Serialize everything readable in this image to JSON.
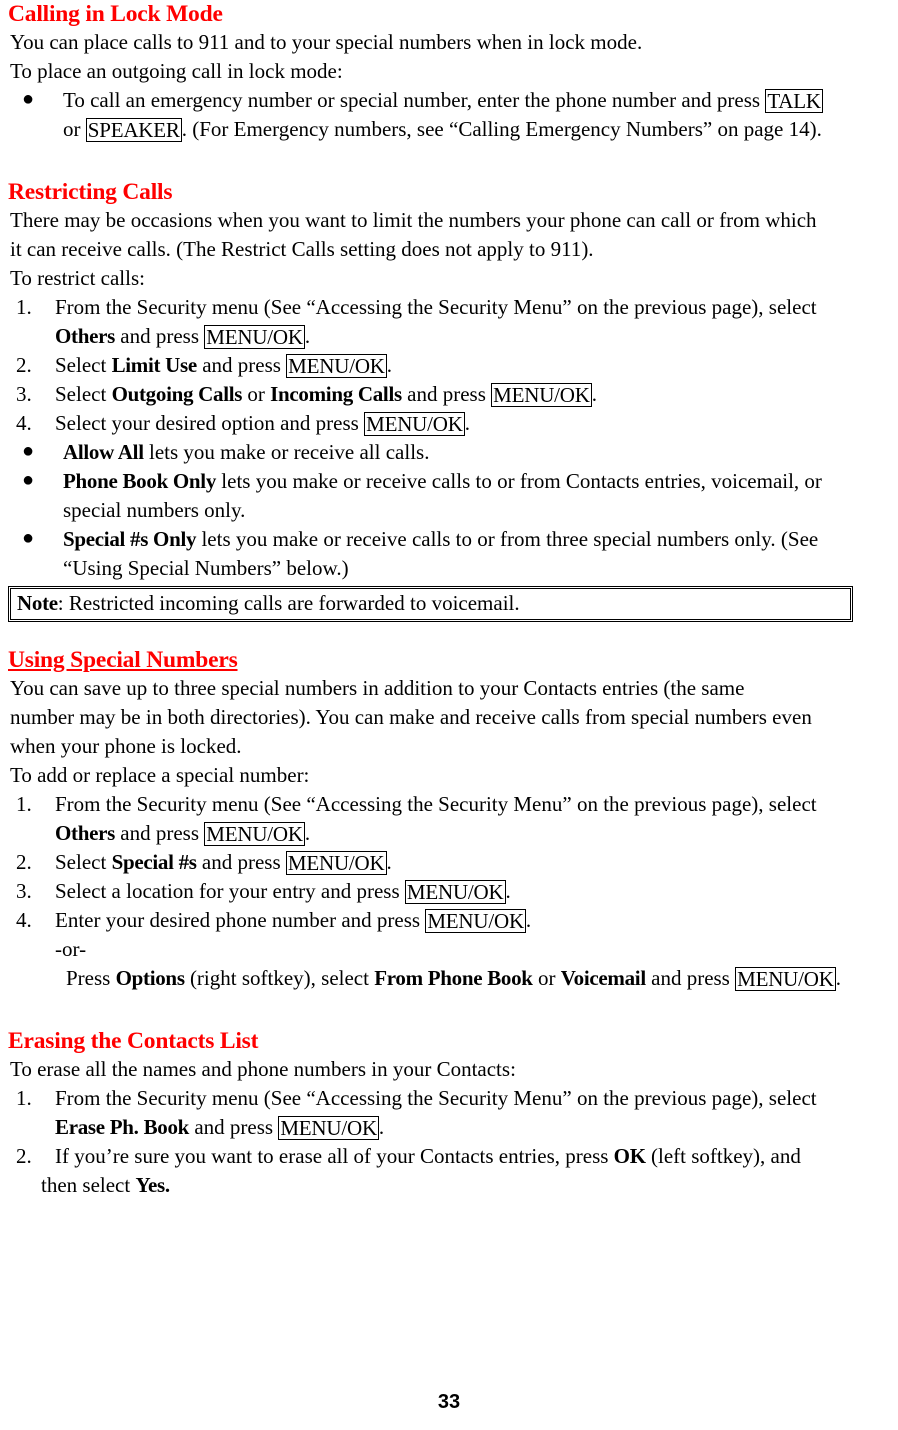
{
  "document": {
    "page_number": "33",
    "heading_color": "#ff0000",
    "text_color": "#000000",
    "background": "#ffffff"
  },
  "sections": [
    {
      "id": "calling-in-lock-mode",
      "heading": "Calling in Lock Mode",
      "heading_style": "red-bold",
      "paragraphs": [
        "You can place calls to 911 and to your special numbers when in lock mode.",
        "To place an outgoing call in lock mode:"
      ],
      "bullets": [
        {
          "lead_bold": "",
          "line1_pre": "To call an emergency number or special number, enter the phone number and press ",
          "key1": "TALK",
          "line2_pre": "or ",
          "key2": "SPEAKER",
          "line2_post": ". (For Emergency numbers, see “Calling Emergency Numbers” on page 14)."
        }
      ]
    },
    {
      "id": "restricting-calls",
      "heading": "Restricting Calls",
      "heading_style": "red-bold",
      "paragraphs": [
        "There may be occasions when you want to limit the numbers your phone can call or from which",
        "it can receive calls. (The Restrict Calls setting does not apply to 911).",
        "To restrict calls:"
      ],
      "steps": [
        {
          "num": "1.",
          "line1": "From the Security menu (See “Accessing the Security Menu” on the previous page), select",
          "line2_bold": "Others",
          "line2_mid": " and press ",
          "line2_key": "MENU/OK",
          "line2_end": "."
        },
        {
          "num": "2.",
          "pre": "Select ",
          "bold1": "Limit Use",
          "mid": " and press ",
          "key": "MENU/OK",
          "end": "."
        },
        {
          "num": "3.",
          "pre": "Select ",
          "bold1": "Outgoing Calls",
          "conj": " or ",
          "bold2": "Incoming Calls",
          "mid": " and press ",
          "key": "MENU/OK",
          "end": "."
        },
        {
          "num": "4.",
          "pre": "Select your desired option and press ",
          "key": "MENU/OK",
          "end": "."
        }
      ],
      "option_bullets": [
        {
          "bold": "Allow All",
          "text": " lets you make or receive all calls."
        },
        {
          "bold": "Phone Book Only",
          "text": " lets you make or receive calls to or from Contacts entries, voicemail, or",
          "text2": "special numbers only."
        },
        {
          "bold": "Special #s Only",
          "text": " lets you make or receive calls to or from three special numbers only. (See",
          "text2": "“Using Special Numbers” below.)"
        }
      ],
      "note": {
        "label": "Note",
        "text": ": Restricted incoming calls are forwarded to voicemail."
      }
    },
    {
      "id": "using-special-numbers",
      "heading": "Using Special Numbers",
      "heading_style": "red-bold-underline",
      "paragraphs": [
        "You can save up to three special numbers in addition to your Contacts entries (the same",
        "number may be in both directories). You can make and receive calls from special numbers even",
        "when your phone is locked.",
        "To add or replace a special number:"
      ],
      "steps": [
        {
          "num": "1.",
          "line1": "From the Security menu (See “Accessing the Security Menu” on the previous page), select",
          "line2_bold": "Others",
          "line2_mid": " and press ",
          "line2_key": "MENU/OK",
          "line2_end": "."
        },
        {
          "num": "2.",
          "pre": "Select ",
          "bold1": "Special #s",
          "mid": " and press ",
          "key": "MENU/OK",
          "end": "."
        },
        {
          "num": "3.",
          "pre": "Select a location for your entry and press ",
          "key": "MENU/OK",
          "end": "."
        },
        {
          "num": "4.",
          "pre": "Enter your desired phone number and press ",
          "key": "MENU/OK",
          "end": "."
        }
      ],
      "alternative": {
        "or_label": "-or-",
        "pre": "Press ",
        "bold1": "Options",
        "mid1": " (right softkey), select ",
        "bold2": "From Phone Book",
        "conj": " or ",
        "bold3": "Voicemail",
        "mid2": " and press ",
        "key": "MENU/OK",
        "end": "."
      }
    },
    {
      "id": "erasing-the-contacts-list",
      "heading": "Erasing the Contacts List",
      "heading_style": "red-bold",
      "paragraphs": [
        "To erase all the names and phone numbers in your Contacts:"
      ],
      "steps": [
        {
          "num": "1.",
          "line1": "From the Security menu (See “Accessing the Security Menu” on the previous page), select",
          "line2_bold": "Erase Ph. Book",
          "line2_mid": " and press ",
          "line2_key": "MENU/OK",
          "line2_end": "."
        },
        {
          "num": "2.",
          "pre": "If you’re sure you want to erase all of your Contacts entries, press ",
          "bold1": "OK",
          "mid": " (left softkey), and",
          "line2_pre": "then select ",
          "line2_bold": "Yes."
        }
      ]
    }
  ]
}
